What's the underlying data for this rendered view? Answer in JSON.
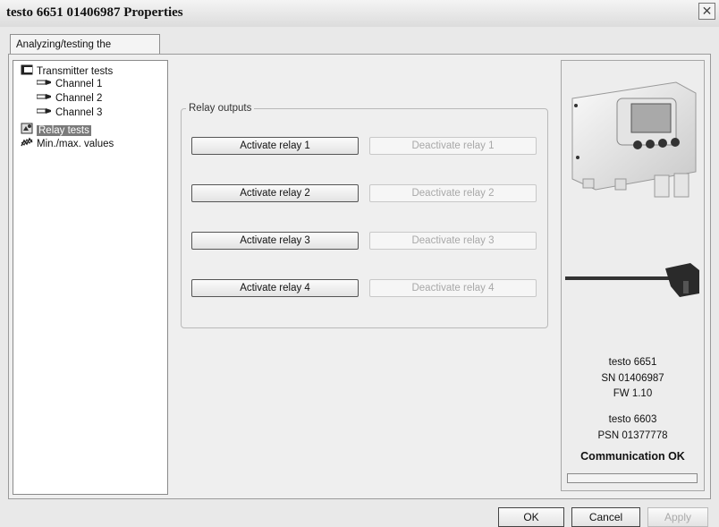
{
  "window": {
    "title": "testo 6651  01406987 Properties",
    "close_glyph": "✕"
  },
  "tab": {
    "label": "Analyzing/testing the transmitter"
  },
  "tree": {
    "items": [
      {
        "label": "Transmitter tests",
        "icon": "transmitter-icon"
      },
      {
        "label": "Channel 1",
        "icon": "probe-icon"
      },
      {
        "label": "Channel 2",
        "icon": "probe-icon"
      },
      {
        "label": "Channel 3",
        "icon": "probe-icon"
      },
      {
        "label": "Relay tests",
        "icon": "relay-icon",
        "selected": true
      },
      {
        "label": "Min./max. values",
        "icon": "chart-icon"
      }
    ]
  },
  "relay_outputs": {
    "group_label": "Relay outputs",
    "relays": [
      {
        "activate": "Activate relay 1",
        "deactivate": "Deactivate relay 1"
      },
      {
        "activate": "Activate relay 2",
        "deactivate": "Deactivate relay 2"
      },
      {
        "activate": "Activate relay 3",
        "deactivate": "Deactivate relay 3"
      },
      {
        "activate": "Activate relay 4",
        "deactivate": "Deactivate relay 4"
      }
    ]
  },
  "device_info": {
    "model": "testo 6651",
    "sn": "SN 01406987",
    "fw": "FW  1.10",
    "probe_model": "testo 6603",
    "psn": "PSN 01377778",
    "status": "Communication OK",
    "progress": 0
  },
  "footer": {
    "ok": "OK",
    "cancel": "Cancel",
    "apply": "Apply"
  }
}
